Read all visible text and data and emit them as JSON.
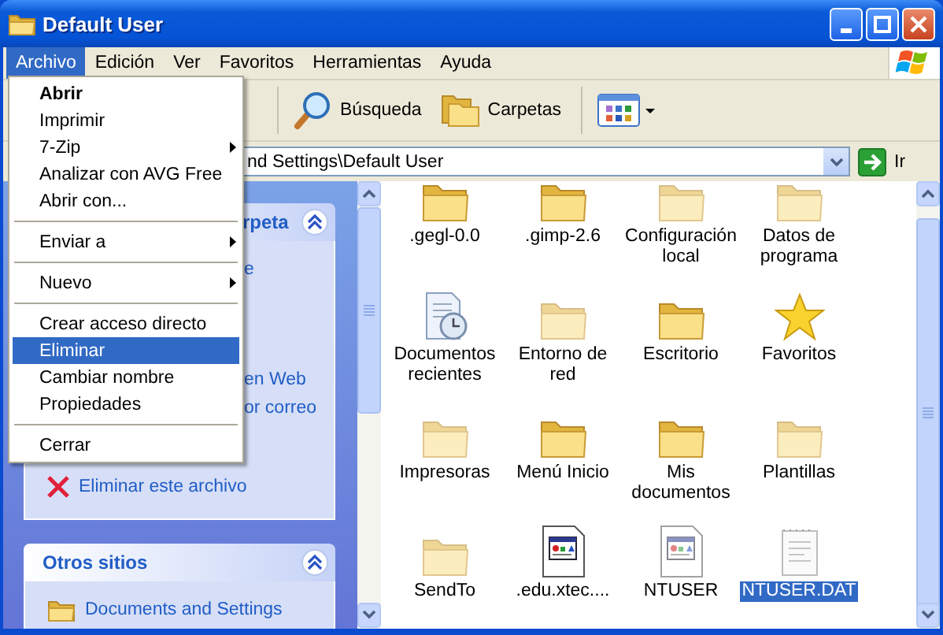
{
  "window": {
    "title": "Default User"
  },
  "menu_bar": [
    {
      "label": "Archivo",
      "selected": true
    },
    {
      "label": "Edición",
      "selected": false
    },
    {
      "label": "Ver",
      "selected": false
    },
    {
      "label": "Favoritos",
      "selected": false
    },
    {
      "label": "Herramientas",
      "selected": false
    },
    {
      "label": "Ayuda",
      "selected": false
    }
  ],
  "toolbar": [
    {
      "label": "Búsqueda",
      "kind": "search"
    },
    {
      "label": "Carpetas",
      "kind": "folders"
    }
  ],
  "address_bar": {
    "value": "nd Settings\\Default User",
    "go_label": "Ir"
  },
  "file_menu": [
    {
      "kind": "item",
      "label": "Abrir",
      "bold": true,
      "submenu": false,
      "selected": false
    },
    {
      "kind": "item",
      "label": "Imprimir",
      "bold": false,
      "submenu": false,
      "selected": false
    },
    {
      "kind": "item",
      "label": "7-Zip",
      "bold": false,
      "submenu": true,
      "selected": false
    },
    {
      "kind": "item",
      "label": "Analizar con AVG Free",
      "bold": false,
      "submenu": false,
      "selected": false
    },
    {
      "kind": "item",
      "label": "Abrir con...",
      "bold": false,
      "submenu": false,
      "selected": false
    },
    {
      "kind": "separator"
    },
    {
      "kind": "item",
      "label": "Enviar a",
      "bold": false,
      "submenu": true,
      "selected": false
    },
    {
      "kind": "separator"
    },
    {
      "kind": "item",
      "label": "Nuevo",
      "bold": false,
      "submenu": true,
      "selected": false
    },
    {
      "kind": "separator"
    },
    {
      "kind": "item",
      "label": "Crear acceso directo",
      "bold": false,
      "submenu": false,
      "selected": false
    },
    {
      "kind": "item",
      "label": "Eliminar",
      "bold": false,
      "submenu": false,
      "selected": true
    },
    {
      "kind": "item",
      "label": "Cambiar nombre",
      "bold": false,
      "submenu": false,
      "selected": false
    },
    {
      "kind": "item",
      "label": "Propiedades",
      "bold": false,
      "submenu": false,
      "selected": false
    },
    {
      "kind": "separator"
    },
    {
      "kind": "item",
      "label": "Cerrar",
      "bold": false,
      "submenu": false,
      "selected": false
    }
  ],
  "task_pane": [
    {
      "title": "rpeta",
      "expanded": true,
      "items": [
        {
          "label": "e",
          "kind": "fragment"
        },
        {
          "label": "en Web",
          "kind": "fragment"
        },
        {
          "label": "or correo",
          "kind": "fragment"
        },
        {
          "label": "Eliminar este archivo",
          "kind": "delete"
        }
      ]
    },
    {
      "title": "Otros sitios",
      "expanded": true,
      "items": [
        {
          "label": "Documents and Settings",
          "kind": "folder"
        }
      ]
    }
  ],
  "files": [
    {
      "label": ".gegl-0.0",
      "kind": "folder",
      "hidden": false,
      "selected": false
    },
    {
      "label": ".gimp-2.6",
      "kind": "folder",
      "hidden": false,
      "selected": false
    },
    {
      "label": "Configuración local",
      "kind": "folder",
      "hidden": true,
      "selected": false
    },
    {
      "label": "Datos de programa",
      "kind": "folder",
      "hidden": true,
      "selected": false
    },
    {
      "label": "Documentos recientes",
      "kind": "recent",
      "hidden": false,
      "selected": false
    },
    {
      "label": "Entorno de red",
      "kind": "folder",
      "hidden": true,
      "selected": false
    },
    {
      "label": "Escritorio",
      "kind": "folder",
      "hidden": false,
      "selected": false
    },
    {
      "label": "Favoritos",
      "kind": "star",
      "hidden": false,
      "selected": false
    },
    {
      "label": "Impresoras",
      "kind": "folder",
      "hidden": true,
      "selected": false
    },
    {
      "label": "Menú Inicio",
      "kind": "folder",
      "hidden": false,
      "selected": false
    },
    {
      "label": "Mis documentos",
      "kind": "folder",
      "hidden": false,
      "selected": false
    },
    {
      "label": "Plantillas",
      "kind": "folder",
      "hidden": true,
      "selected": false
    },
    {
      "label": "SendTo",
      "kind": "folder",
      "hidden": true,
      "selected": false
    },
    {
      "label": ".edu.xtec....",
      "kind": "appfile",
      "hidden": false,
      "selected": false
    },
    {
      "label": "NTUSER",
      "kind": "appfile",
      "hidden": true,
      "selected": false
    },
    {
      "label": "NTUSER.DAT",
      "kind": "textfile",
      "hidden": true,
      "selected": true
    }
  ]
}
